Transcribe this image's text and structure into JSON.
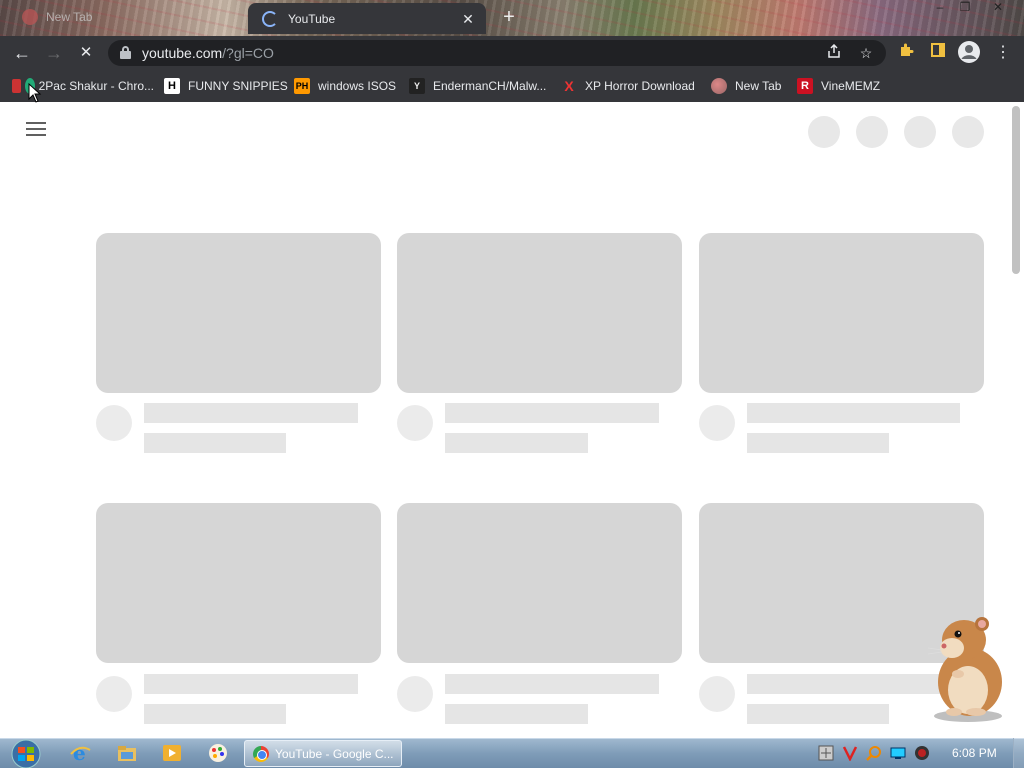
{
  "tabs": {
    "inactive_label": "New Tab",
    "active_label": "YouTube",
    "close_glyph": "✕",
    "new_tab_glyph": "+"
  },
  "window_controls": {
    "minimize": "–",
    "restore": "❐",
    "close": "✕"
  },
  "toolbar": {
    "back_glyph": "←",
    "forward_glyph": "→",
    "reload_glyph": "✕",
    "url_host": "youtube.com",
    "url_path": "/?gl=CO"
  },
  "bookmarks": [
    {
      "label": "2Pac Shakur - Chro...",
      "icon": "2pac-icon"
    },
    {
      "label": "FUNNY SNIPPIES",
      "icon": "h-icon",
      "icon_text": "H"
    },
    {
      "label": "windows ISOS",
      "icon": "ph-icon",
      "icon_text": "PH"
    },
    {
      "label": "EndermanCH/Malw...",
      "icon": "yp-icon",
      "icon_text": "Y"
    },
    {
      "label": "XP Horror Download",
      "icon": "x-icon",
      "icon_text": "X"
    },
    {
      "label": "New Tab",
      "icon": "globe-icon"
    },
    {
      "label": "VineMEMZ",
      "icon": "r-icon",
      "icon_text": "R"
    }
  ],
  "taskbar": {
    "window_label": "YouTube - Google C...",
    "clock": "6:08 PM"
  },
  "colors": {
    "chrome_dark": "#35363a",
    "omnibox": "#202124",
    "skeleton_thumb": "#d6d6d6",
    "skeleton_line": "#e5e5e5",
    "taskbar": "#7f9cb8"
  }
}
